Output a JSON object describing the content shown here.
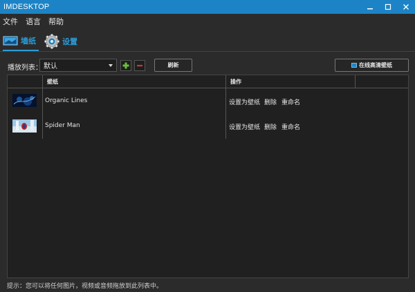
{
  "window": {
    "title": "IMDESKTOP"
  },
  "menu": [
    "文件",
    "语言",
    "帮助"
  ],
  "tabs": [
    {
      "label": "墙纸",
      "icon": "wallpaper-icon",
      "active": true
    },
    {
      "label": "设置",
      "icon": "gear-icon",
      "active": false
    }
  ],
  "toolbar": {
    "playlist_label": "播放列表：",
    "playlist_selected": "默认",
    "refresh_label": "刷新",
    "online_label": "在线高清壁纸"
  },
  "table": {
    "headers": [
      "壁纸",
      "操作"
    ],
    "rows": [
      {
        "name": "Organic Lines",
        "thumb": "organic-lines-thumbnail",
        "actions": [
          "设置为壁纸",
          "删除",
          "重命名"
        ]
      },
      {
        "name": "Spider Man",
        "thumb": "spider-man-thumbnail",
        "actions": [
          "设置为壁纸",
          "删除",
          "重命名"
        ]
      }
    ]
  },
  "status": "提示：您可以将任何图片，视频或音频拖放到此列表中。",
  "colors": {
    "accent": "#1c84c6",
    "tab_active": "#2a9bd8",
    "add": "#6abf3a",
    "remove": "#d9342b"
  }
}
